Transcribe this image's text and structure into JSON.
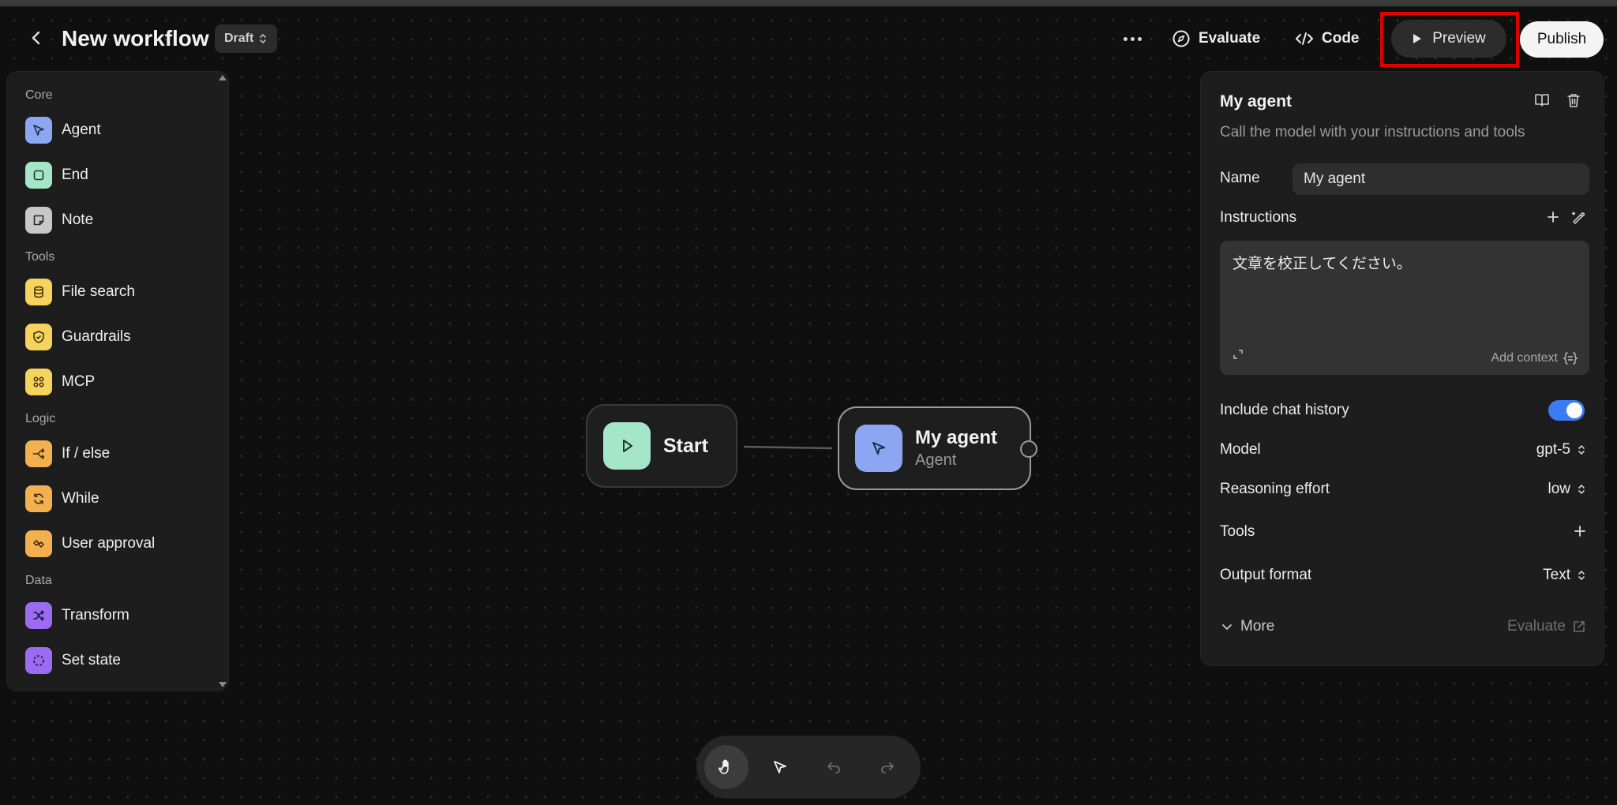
{
  "header": {
    "title": "New workflow",
    "status": "Draft",
    "evaluate_label": "Evaluate",
    "code_label": "Code",
    "preview_label": "Preview",
    "publish_label": "Publish"
  },
  "sidebar": {
    "sections": [
      {
        "label": "Core",
        "items": [
          {
            "label": "Agent",
            "icon": "cursor-icon",
            "color": "#8ca6f2"
          },
          {
            "label": "End",
            "icon": "stop-icon",
            "color": "#a6e6c8"
          },
          {
            "label": "Note",
            "icon": "note-icon",
            "color": "#c8c8c8"
          }
        ]
      },
      {
        "label": "Tools",
        "items": [
          {
            "label": "File search",
            "icon": "database-icon",
            "color": "#f5d35c"
          },
          {
            "label": "Guardrails",
            "icon": "shield-icon",
            "color": "#f5d35c"
          },
          {
            "label": "MCP",
            "icon": "mcp-icon",
            "color": "#f5d35c"
          }
        ]
      },
      {
        "label": "Logic",
        "items": [
          {
            "label": "If / else",
            "icon": "branch-icon",
            "color": "#f3b04f"
          },
          {
            "label": "While",
            "icon": "loop-icon",
            "color": "#f3b04f"
          },
          {
            "label": "User approval",
            "icon": "approval-icon",
            "color": "#f3b04f"
          }
        ]
      },
      {
        "label": "Data",
        "items": [
          {
            "label": "Transform",
            "icon": "shuffle-icon",
            "color": "#9b6cf2"
          },
          {
            "label": "Set state",
            "icon": "state-icon",
            "color": "#9b6cf2"
          }
        ]
      }
    ]
  },
  "nodes": {
    "start": {
      "label": "Start",
      "color": "#a6e6c8"
    },
    "agent": {
      "label": "My agent",
      "type": "Agent",
      "color": "#8ca6f2"
    }
  },
  "inspector": {
    "title": "My agent",
    "description": "Call the model with your instructions and tools",
    "name_label": "Name",
    "name_value": "My agent",
    "instructions_label": "Instructions",
    "instructions_text": "文章を校正してください。",
    "add_context_label": "Add context",
    "include_chat_history_label": "Include chat history",
    "include_chat_history": true,
    "model_label": "Model",
    "model_value": "gpt-5",
    "reasoning_label": "Reasoning effort",
    "reasoning_value": "low",
    "tools_label": "Tools",
    "output_format_label": "Output format",
    "output_format_value": "Text",
    "more_label": "More",
    "evaluate_label": "Evaluate"
  },
  "toolbar": {
    "tools": [
      "hand-icon",
      "pointer-icon",
      "undo-icon",
      "redo-icon"
    ],
    "active": "hand-icon"
  }
}
